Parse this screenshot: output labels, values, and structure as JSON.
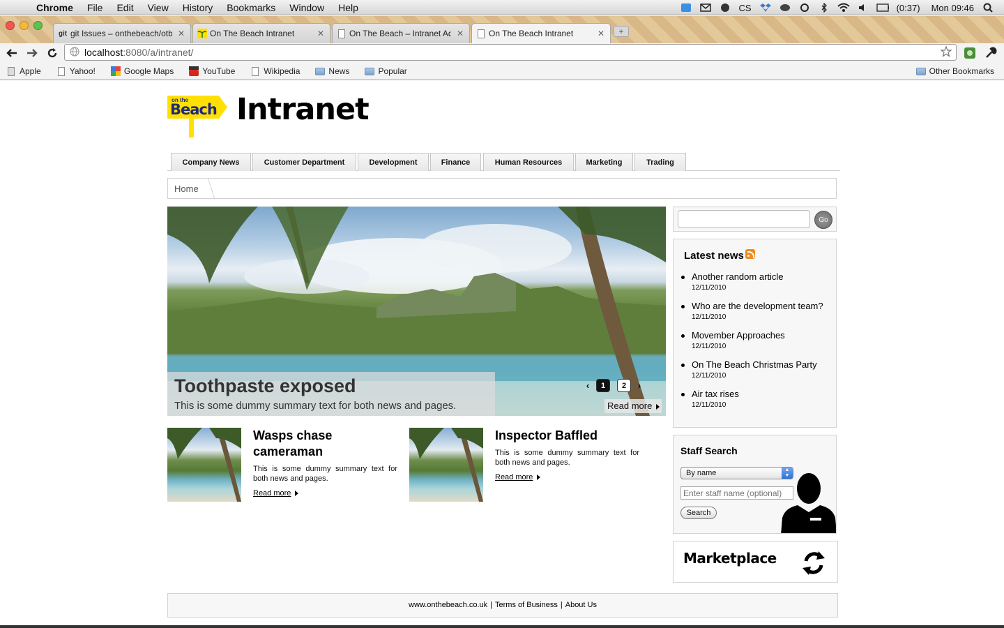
{
  "menubar": {
    "app": "Chrome",
    "items": [
      "File",
      "Edit",
      "View",
      "History",
      "Bookmarks",
      "Window",
      "Help"
    ],
    "battery": "(0:37)",
    "clock": "Mon 09:46",
    "cs_label": "CS"
  },
  "tabs": [
    {
      "title": "git Issues – onthebeach/otb_intranet",
      "close": "✕"
    },
    {
      "title": "On The Beach Intranet",
      "close": "✕"
    },
    {
      "title": "On The Beach – Intranet Admin",
      "close": "✕"
    },
    {
      "title": "On The Beach Intranet",
      "close": "✕"
    }
  ],
  "newtab_glyph": "+",
  "omnibox": {
    "url_host": "localhost",
    "url_path": ":8080/a/intranet/"
  },
  "bookmarks": [
    "Apple",
    "Yahoo!",
    "Google Maps",
    "YouTube",
    "Wikipedia",
    "News",
    "Popular"
  ],
  "bookmarks_other": "Other Bookmarks",
  "site": {
    "logo_small": "on the",
    "logo_word": "Beach",
    "title": "Intranet"
  },
  "nav": [
    {
      "label": "Company News"
    },
    {
      "label": "Customer Department"
    },
    {
      "label": "Development"
    },
    {
      "label": "Finance"
    },
    {
      "label": "Human Resources"
    },
    {
      "label": "Marketing"
    },
    {
      "label": "Trading"
    }
  ],
  "breadcrumb": {
    "home": "Home"
  },
  "hero": {
    "title": "Toothpaste exposed",
    "summary": "This is some dummy summary text for both news and pages.",
    "read_more": "Read more",
    "pages": [
      "1",
      "2"
    ],
    "current_page": "1"
  },
  "news": [
    {
      "title": "Wasps chase cameraman",
      "summary": "This is some dummy summary text for both news and pages.",
      "read_more": "Read more"
    },
    {
      "title": "Inspector Baffled",
      "summary": "This is some dummy summary text for both news and pages.",
      "read_more": "Read more"
    }
  ],
  "search": {
    "go": "Go",
    "value": ""
  },
  "latest_news": {
    "title": "Latest news",
    "items": [
      {
        "title": "Another random article",
        "date": "12/11/2010"
      },
      {
        "title": "Who are the development team?",
        "date": "12/11/2010"
      },
      {
        "title": "Movember Approaches",
        "date": "12/11/2010"
      },
      {
        "title": "On The Beach Christmas Party",
        "date": "12/11/2010"
      },
      {
        "title": "Air tax rises",
        "date": "12/11/2010"
      }
    ]
  },
  "staff_search": {
    "title": "Staff Search",
    "selected": "By name",
    "placeholder": "Enter staff name (optional)",
    "button": "Search"
  },
  "marketplace": {
    "title": "Marketplace"
  },
  "footer": {
    "links": [
      "www.onthebeach.co.uk",
      "Terms of Business",
      "About Us"
    ],
    "separator": "|"
  },
  "colors": {
    "logo_yellow": "#ffe000",
    "logo_blue": "#1e2a80",
    "rss_orange": "#f08b1d"
  }
}
